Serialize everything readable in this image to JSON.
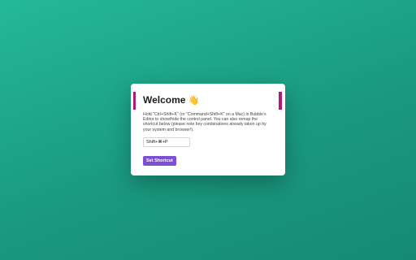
{
  "modal": {
    "title": "Welcome",
    "title_emoji": "👋",
    "description": "Hold \"Ctrl+Shift+K\" (or \"Command+Shift+K\" on a Mac) in Bubble's Editor to show/hide the control panel. You can also remap the shortcut below (please note key combinations already taken up by your system and browser!).",
    "shortcut_value": "Shift+⌘+P",
    "set_button_label": "Set Shortcut"
  },
  "colors": {
    "background": "#1fa98c",
    "accent_button": "#7b4fd6",
    "edge_accent": "#b0197a"
  }
}
